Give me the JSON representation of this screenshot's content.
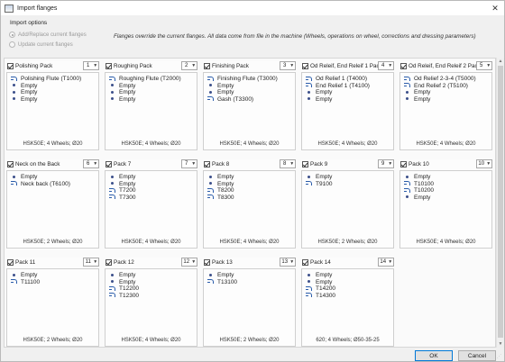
{
  "window": {
    "title": "Import flanges",
    "close": "✕"
  },
  "options": {
    "label": "Import options",
    "radio_add": "Add/Replace current flanges",
    "radio_update": "Update current flanges",
    "note": "Flanges override the current flanges. All data come from file in the machine (Wheels, operations on wheel, corrections and dressing parameters)"
  },
  "packs": [
    {
      "name": "Polishing Pack",
      "num": "1",
      "items": [
        {
          "t": "tool",
          "label": "Polishing Flute (T1000)"
        },
        {
          "t": "empty",
          "label": "Empty"
        },
        {
          "t": "empty",
          "label": "Empty"
        },
        {
          "t": "empty",
          "label": "Empty"
        }
      ],
      "footer": "HSK50E; 4 Wheels; Ø20"
    },
    {
      "name": "Roughing Pack",
      "num": "2",
      "items": [
        {
          "t": "tool",
          "label": "Roughing Flute (T2000)"
        },
        {
          "t": "empty",
          "label": "Empty"
        },
        {
          "t": "empty",
          "label": "Empty"
        },
        {
          "t": "empty",
          "label": "Empty"
        }
      ],
      "footer": "HSK50E; 4 Wheels; Ø20"
    },
    {
      "name": "Finishing Pack",
      "num": "3",
      "items": [
        {
          "t": "tool",
          "label": "Finishing Flute (T3000)"
        },
        {
          "t": "empty",
          "label": "Empty"
        },
        {
          "t": "empty",
          "label": "Empty"
        },
        {
          "t": "tool",
          "label": "Gash (T3300)"
        }
      ],
      "footer": "HSK50E; 4 Wheels; Ø20"
    },
    {
      "name": "Od Releif, End Releif 1 Pack",
      "num": "4",
      "items": [
        {
          "t": "tool",
          "label": "Od Relief 1 (T4000)"
        },
        {
          "t": "tool",
          "label": "End Relief 1 (T4100)"
        },
        {
          "t": "empty",
          "label": "Empty"
        },
        {
          "t": "empty",
          "label": "Empty"
        }
      ],
      "footer": "HSK50E; 4 Wheels; Ø20"
    },
    {
      "name": "Od Releif, End Releif 2 Pack",
      "num": "5",
      "items": [
        {
          "t": "tool",
          "label": "Od Relief 2-3-4 (T5000)"
        },
        {
          "t": "tool",
          "label": "End Relief 2 (T5100)"
        },
        {
          "t": "empty",
          "label": "Empty"
        },
        {
          "t": "empty",
          "label": "Empty"
        }
      ],
      "footer": "HSK50E; 4 Wheels; Ø20"
    },
    {
      "name": "Neck on the Back",
      "num": "6",
      "items": [
        {
          "t": "empty",
          "label": "Empty"
        },
        {
          "t": "tool",
          "label": "Neck back (T6100)"
        }
      ],
      "footer": "HSK50E; 2 Wheels; Ø20"
    },
    {
      "name": "Pack 7",
      "num": "7",
      "items": [
        {
          "t": "empty",
          "label": "Empty"
        },
        {
          "t": "empty",
          "label": "Empty"
        },
        {
          "t": "tool",
          "label": "T7200"
        },
        {
          "t": "tool",
          "label": "T7300"
        }
      ],
      "footer": "HSK50E; 4 Wheels; Ø20"
    },
    {
      "name": "Pack 8",
      "num": "8",
      "items": [
        {
          "t": "empty",
          "label": "Empty"
        },
        {
          "t": "empty",
          "label": "Empty"
        },
        {
          "t": "tool",
          "label": "T8200"
        },
        {
          "t": "tool",
          "label": "T8300"
        }
      ],
      "footer": "HSK50E; 4 Wheels; Ø20"
    },
    {
      "name": "Pack 9",
      "num": "9",
      "items": [
        {
          "t": "empty",
          "label": "Empty"
        },
        {
          "t": "tool",
          "label": "T9100"
        }
      ],
      "footer": "HSK50E; 2 Wheels; Ø20"
    },
    {
      "name": "Pack 10",
      "num": "10",
      "items": [
        {
          "t": "empty",
          "label": "Empty"
        },
        {
          "t": "tool",
          "label": "T10100"
        },
        {
          "t": "tool",
          "label": "T10200"
        },
        {
          "t": "empty",
          "label": "Empty"
        }
      ],
      "footer": "HSK50E; 4 Wheels; Ø20"
    },
    {
      "name": "Pack 11",
      "num": "11",
      "items": [
        {
          "t": "empty",
          "label": "Empty"
        },
        {
          "t": "tool",
          "label": "T11100"
        }
      ],
      "footer": "HSK50E; 2 Wheels; Ø20"
    },
    {
      "name": "Pack 12",
      "num": "12",
      "items": [
        {
          "t": "empty",
          "label": "Empty"
        },
        {
          "t": "empty",
          "label": "Empty"
        },
        {
          "t": "tool",
          "label": "T12200"
        },
        {
          "t": "tool",
          "label": "T12300"
        }
      ],
      "footer": "HSK50E; 4 Wheels; Ø20"
    },
    {
      "name": "Pack 13",
      "num": "13",
      "items": [
        {
          "t": "empty",
          "label": "Empty"
        },
        {
          "t": "tool",
          "label": "T13100"
        }
      ],
      "footer": "HSK50E; 2 Wheels; Ø20"
    },
    {
      "name": "Pack 14",
      "num": "14",
      "items": [
        {
          "t": "empty",
          "label": "Empty"
        },
        {
          "t": "empty",
          "label": "Empty"
        },
        {
          "t": "tool",
          "label": "T14200"
        },
        {
          "t": "tool",
          "label": "T14300"
        }
      ],
      "footer": "620; 4 Wheels; Ø50-35-25"
    }
  ],
  "buttons": {
    "ok": "OK",
    "cancel": "Cancel"
  }
}
